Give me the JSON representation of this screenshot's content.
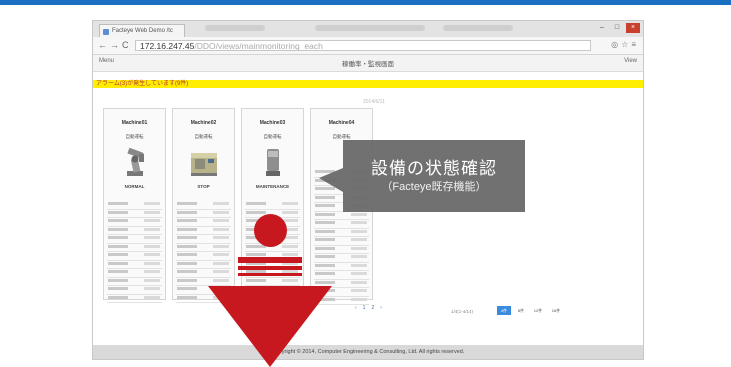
{
  "browser": {
    "tab_label": "Facteye Web Demo /tc",
    "address": {
      "ip": "172.16.247.45",
      "path": "/DDO/views/mainmonitoring_each"
    }
  },
  "app": {
    "left_label": "Menu",
    "title": "稼働率・監視画面",
    "right_label": "View"
  },
  "alert_text": "アラーム(3)が発生しています(9件)",
  "update_text": "2014/6/11",
  "machines": [
    {
      "name": "Machine01",
      "state": "自動運転",
      "status": "NORMAL",
      "image": "robot-arm-icon"
    },
    {
      "name": "Machine02",
      "state": "自動運転",
      "status": "STOP",
      "image": "cnc-machine-icon"
    },
    {
      "name": "Machine03",
      "state": "自動運転",
      "status": "MAINTENANCE",
      "image": "grinder-icon"
    },
    {
      "name": "Machine04",
      "state": "自動運転",
      "status": "",
      "image": "empty-slot"
    }
  ],
  "pagination": {
    "pages": [
      "‹",
      "1",
      "2",
      "›"
    ],
    "count_text": "1/4(1-4/14)",
    "size_buttons": [
      "4件",
      "8件",
      "12件",
      "16件"
    ]
  },
  "footer_text": "Copyright © 2014, Computer Engineering & Consulting, Ltd. All rights reserved.",
  "callout": {
    "line1": "設備の状態確認",
    "line2": "（Facteye既存機能）"
  },
  "colors": {
    "accent": "#1b6fc2",
    "alert_bg": "#ffee00",
    "scroll_indicator": "#c8181f",
    "callout_bg": "#696969"
  }
}
